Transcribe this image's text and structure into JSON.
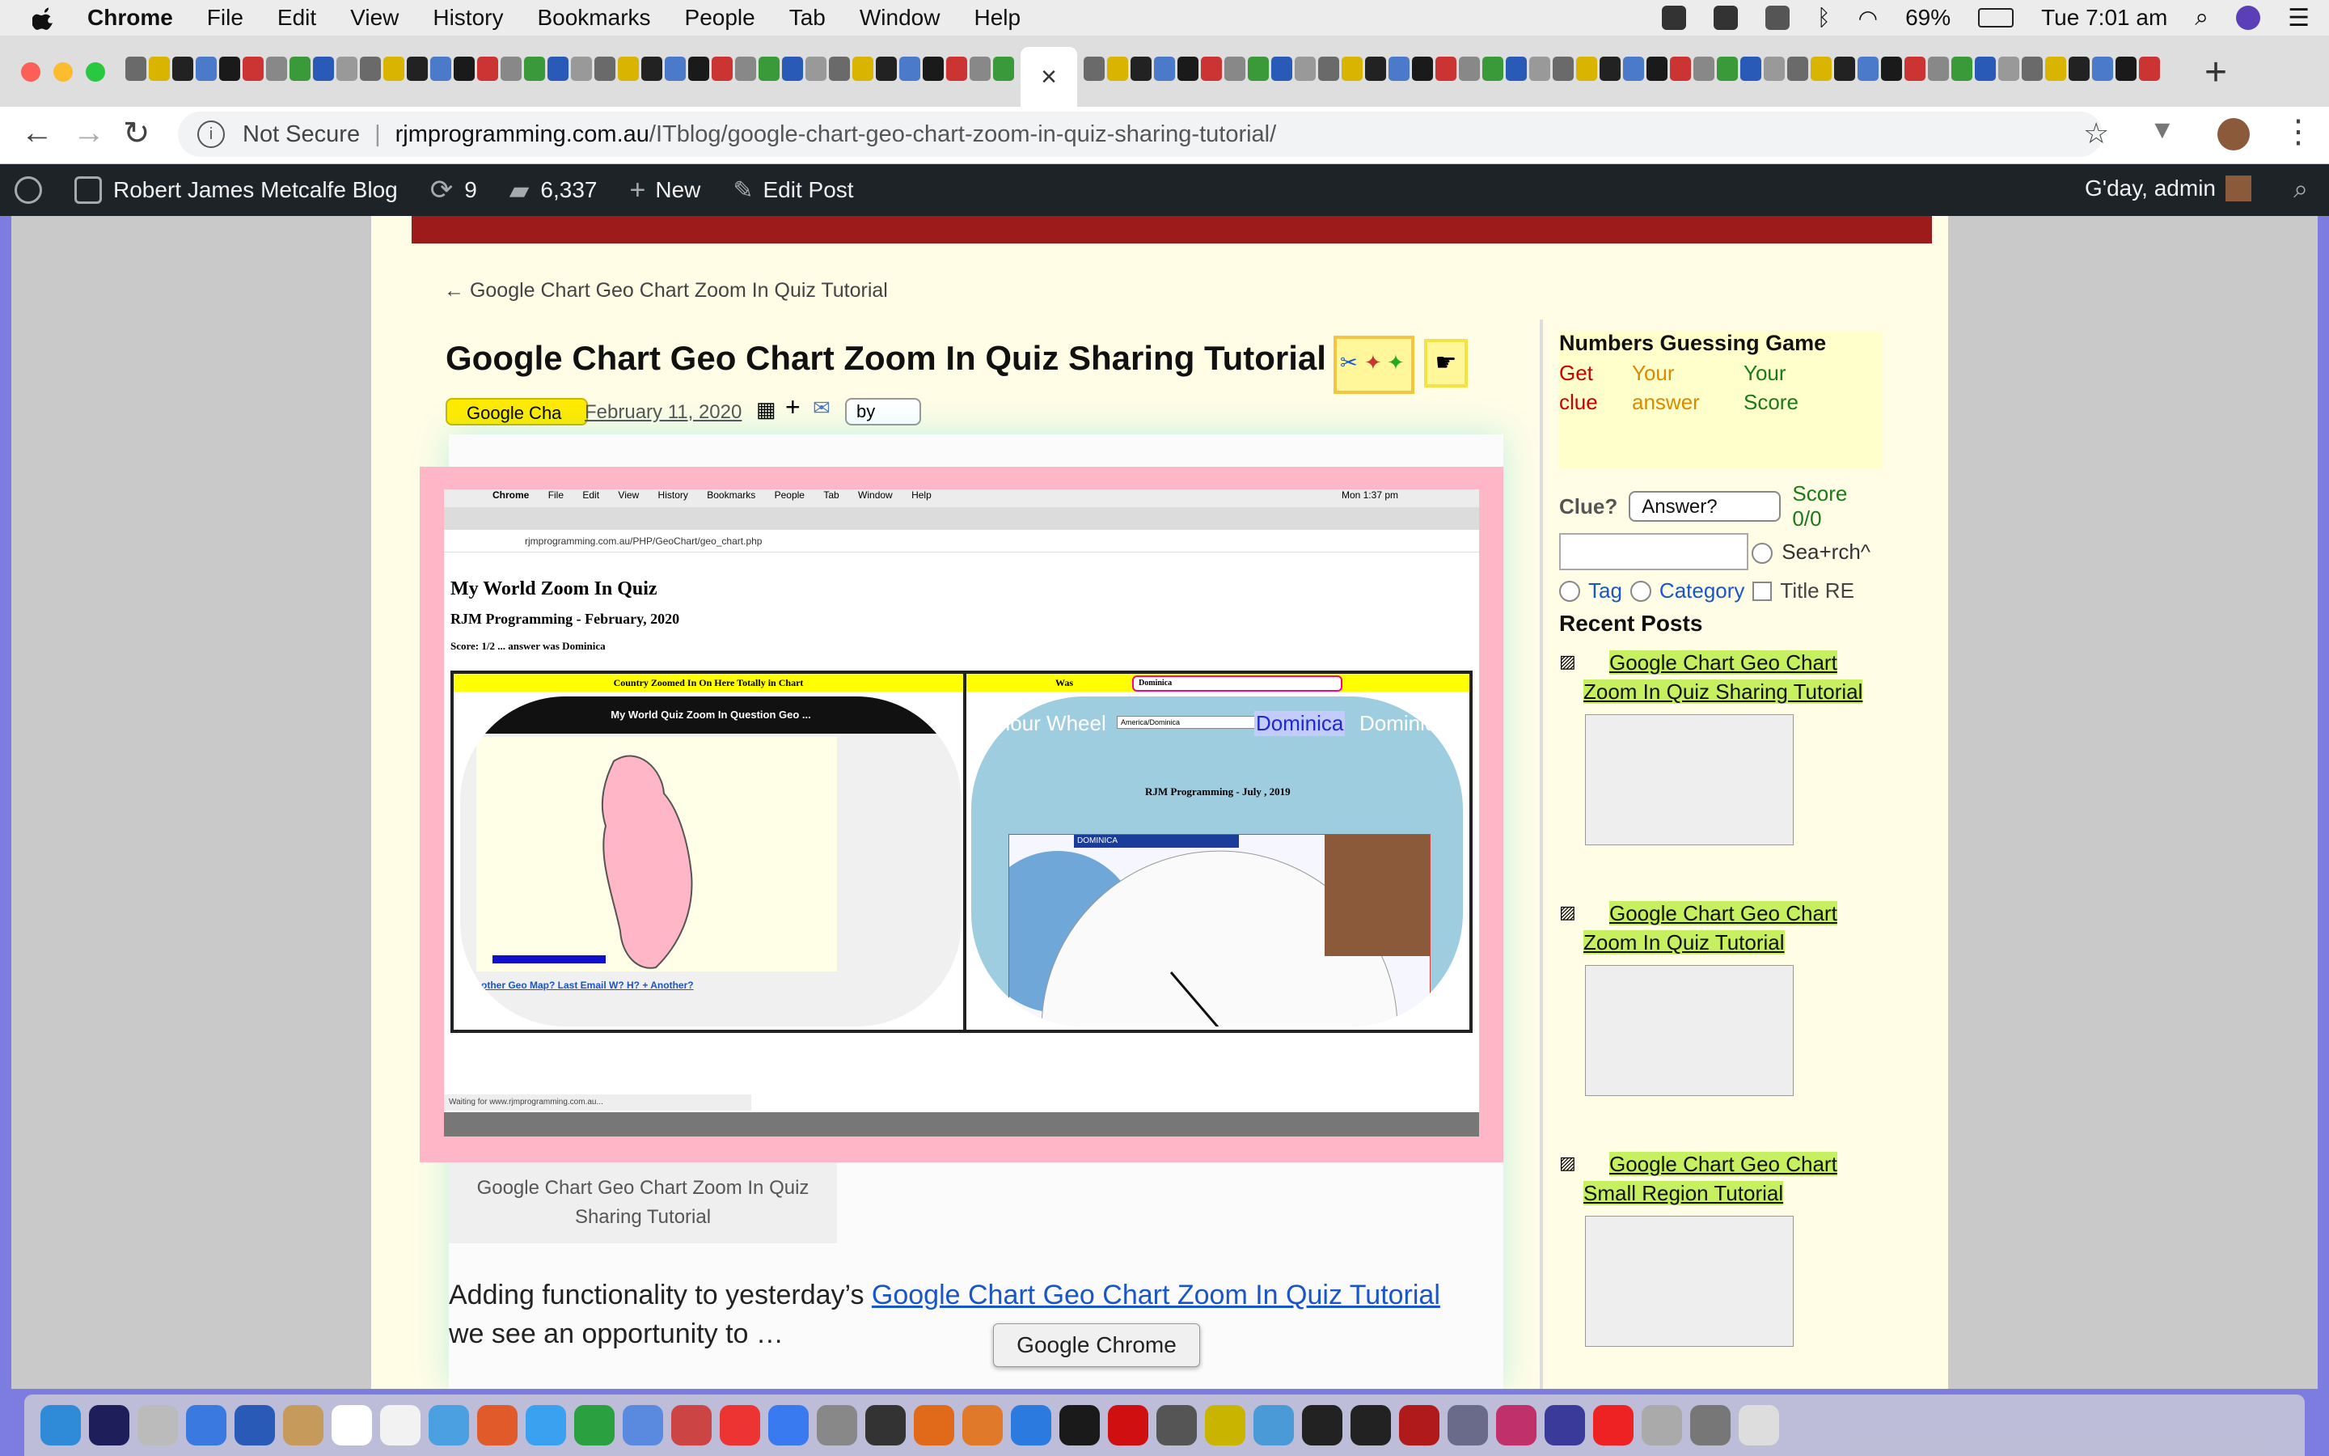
{
  "menubar": {
    "items": [
      "Chrome",
      "File",
      "Edit",
      "View",
      "History",
      "Bookmarks",
      "People",
      "Tab",
      "Window",
      "Help"
    ],
    "battery": "69%",
    "clock": "Tue 7:01 am"
  },
  "tabs": {
    "active_close": "×",
    "new_tab": "+"
  },
  "toolbar": {
    "security": "Not Secure",
    "separator": "|",
    "host": "rjmprogramming.com.au",
    "path": "/ITblog/google-chart-geo-chart-zoom-in-quiz-sharing-tutorial/"
  },
  "wpbar": {
    "site": "Robert James Metcalfe Blog",
    "updates": "9",
    "comments": "6,337",
    "new": "New",
    "edit": "Edit Post",
    "greeting": "G'day, admin"
  },
  "post": {
    "prev_link": "← Google Chart Geo Chart Zoom In Quiz Tutorial",
    "title": "Google Chart Geo Chart Zoom In Quiz Sharing Tutorial",
    "category_select": "Google Cha",
    "date": "February 11, 2020",
    "by_select": "by",
    "caption": "Google Chart Geo Chart Zoom In Quiz Sharing Tutorial",
    "body_prefix": "Adding functionality to yesterday’s ",
    "body_link": "Google Chart Geo Chart Zoom In Quiz Tutorial",
    "body_suffix": " we see an opportunity to …"
  },
  "screenshot": {
    "menu": [
      "Chrome",
      "File",
      "Edit",
      "View",
      "History",
      "Bookmarks",
      "People",
      "Tab",
      "Window",
      "Help"
    ],
    "clock": "Mon 1:37 pm",
    "url": "rjmprogramming.com.au/PHP/GeoChart/geo_chart.php",
    "h1": "My World Zoom In Quiz",
    "h2": "RJM Programming - February, 2020",
    "score": "Score: 1/2 ... answer was Dominica",
    "left_header": "Country Zoomed In On Here Totally in Chart",
    "right_header": "Was",
    "select_value": "Dominica",
    "black_banner": "My World Quiz Zoom In Question Geo ...",
    "links": "Another Geo Map?   Last   Email   W?   H?   +   Another?",
    "colour_wheel": "olour Wheel",
    "tz_select": "America/Dominica",
    "dominica": "Dominica",
    "dominica_trail": "Dominic",
    "rjm": "RJM Programming - July , 2019",
    "wheel_label": "DOMINICA",
    "status": "Waiting for www.rjmprogramming.com.au..."
  },
  "sidebar": {
    "game_title": "Numbers Guessing Game",
    "col1": [
      "Get",
      "clue"
    ],
    "col2": [
      "Your",
      "answer"
    ],
    "col3": [
      "Your",
      "Score"
    ],
    "clue_label": "Clue?",
    "answer_select": "Answer?",
    "score": "Score 0/0",
    "search_label": "Sea+rch^",
    "tag": "Tag",
    "category": "Category",
    "title_re": "Title RE",
    "recent_title": "Recent Posts",
    "recent": [
      {
        "line1": "Google Chart Geo Chart",
        "line2": "Zoom In Quiz Sharing Tutorial"
      },
      {
        "line1": "Google Chart Geo Chart",
        "line2": "Zoom In Quiz Tutorial"
      },
      {
        "line1": "Google Chart Geo Chart",
        "line2": "Small Region Tutorial"
      }
    ]
  },
  "tooltip": "Google Chrome"
}
